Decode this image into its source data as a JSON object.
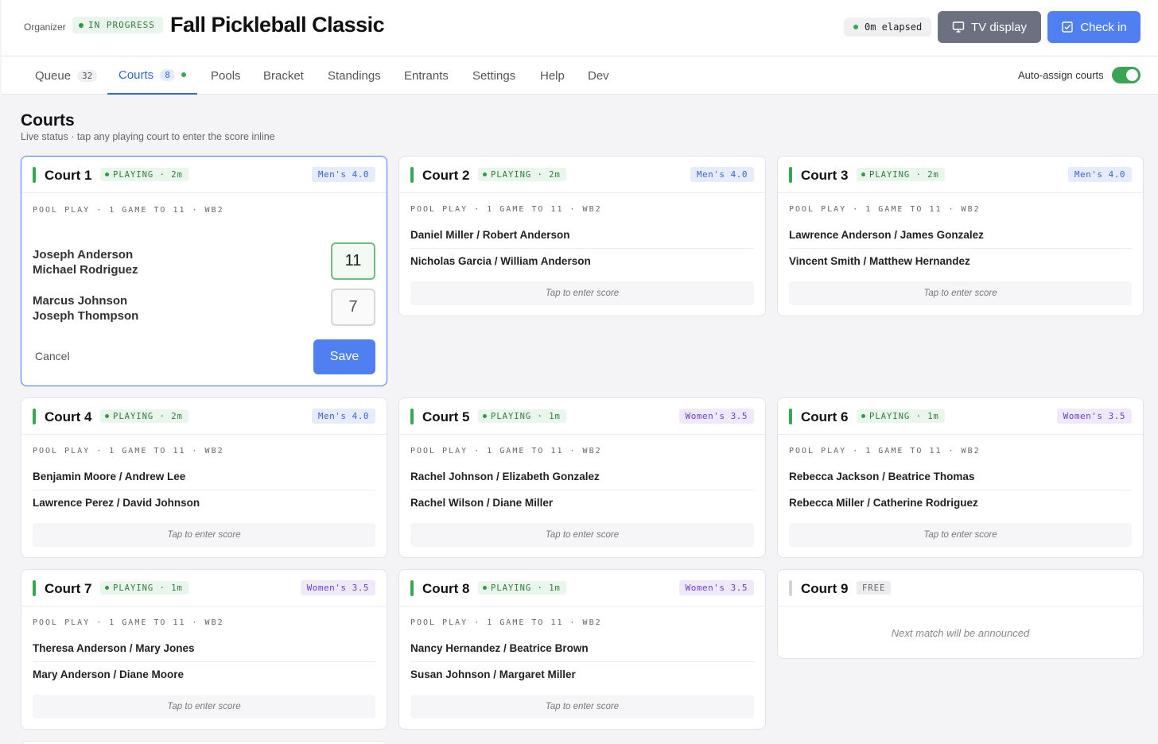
{
  "header": {
    "org_label": "Organizer",
    "status": "IN PROGRESS",
    "title": "Fall Pickleball Classic",
    "elapsed": "0m elapsed",
    "tv_label": "TV display",
    "checkin_label": "Check in"
  },
  "tabs": [
    {
      "label": "Queue",
      "count": "32"
    },
    {
      "label": "Courts",
      "count": "8"
    },
    {
      "label": "Pools"
    },
    {
      "label": "Bracket"
    },
    {
      "label": "Standings"
    },
    {
      "label": "Entrants"
    },
    {
      "label": "Settings"
    },
    {
      "label": "Help"
    },
    {
      "label": "Dev"
    }
  ],
  "auto_assign": {
    "label": "Auto-assign courts",
    "on": true
  },
  "section": {
    "title": "Courts",
    "subtitle": "Live status · tap any playing court to enter the score inline"
  },
  "courts": [
    {
      "name": "Court 1",
      "status": "PLAYING · 2m",
      "division": "Men's 4.0",
      "pool": "POOL PLAY · 1 GAME TO 11 · WB2",
      "team1_a": "Joseph Anderson",
      "team1_b": "Michael Rodriguez",
      "team2_a": "Marcus Johnson",
      "team2_b": "Joseph Thompson",
      "score1": "11",
      "score2": "7",
      "cancel": "Cancel",
      "save": "Save"
    },
    {
      "name": "Court 2",
      "status": "PLAYING · 2m",
      "division": "Men's 4.0",
      "pool": "POOL PLAY · 1 GAME TO 11 · WB2",
      "team1": "Daniel Miller / Robert Anderson",
      "team2": "Nicholas Garcia / William Anderson",
      "tap": "Tap to enter score"
    },
    {
      "name": "Court 3",
      "status": "PLAYING · 2m",
      "division": "Men's 4.0",
      "pool": "POOL PLAY · 1 GAME TO 11 · WB2",
      "team1": "Lawrence Anderson / James Gonzalez",
      "team2": "Vincent Smith / Matthew Hernandez",
      "tap": "Tap to enter score"
    },
    {
      "name": "Court 4",
      "status": "PLAYING · 2m",
      "division": "Men's 4.0",
      "pool": "POOL PLAY · 1 GAME TO 11 · WB2",
      "team1": "Benjamin Moore / Andrew Lee",
      "team2": "Lawrence Perez / David Johnson",
      "tap": "Tap to enter score"
    },
    {
      "name": "Court 5",
      "status": "PLAYING · 1m",
      "division": "Women's 3.5",
      "pool": "POOL PLAY · 1 GAME TO 11 · WB2",
      "team1": "Rachel Johnson / Elizabeth Gonzalez",
      "team2": "Rachel Wilson / Diane Miller",
      "tap": "Tap to enter score"
    },
    {
      "name": "Court 6",
      "status": "PLAYING · 1m",
      "division": "Women's 3.5",
      "pool": "POOL PLAY · 1 GAME TO 11 · WB2",
      "team1": "Rebecca Jackson / Beatrice Thomas",
      "team2": "Rebecca Miller / Catherine Rodriguez",
      "tap": "Tap to enter score"
    },
    {
      "name": "Court 7",
      "status": "PLAYING · 1m",
      "division": "Women's 3.5",
      "pool": "POOL PLAY · 1 GAME TO 11 · WB2",
      "team1": "Theresa Anderson / Mary Jones",
      "team2": "Mary Anderson / Diane Moore",
      "tap": "Tap to enter score"
    },
    {
      "name": "Court 8",
      "status": "PLAYING · 1m",
      "division": "Women's 3.5",
      "pool": "POOL PLAY · 1 GAME TO 11 · WB2",
      "team1": "Nancy Hernandez / Beatrice Brown",
      "team2": "Susan Johnson / Margaret Miller",
      "tap": "Tap to enter score"
    },
    {
      "name": "Court 9",
      "status": "FREE",
      "message": "Next match will be announced"
    }
  ],
  "colors": {
    "accent": "#4f7ff0",
    "playing": "#3aa553",
    "tv_button": "#6b7180"
  }
}
